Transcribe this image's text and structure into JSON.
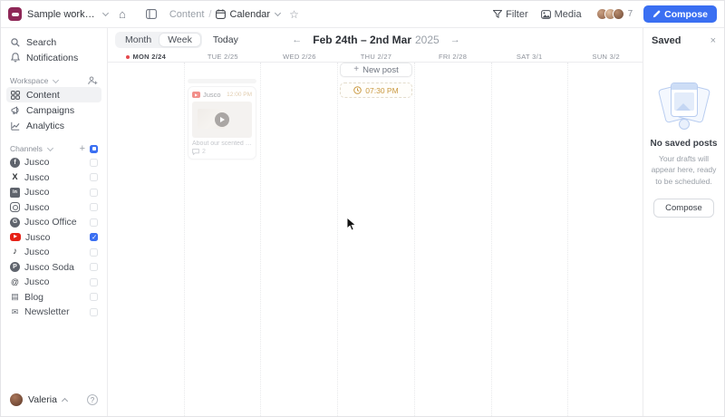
{
  "topbar": {
    "workspace_name": "Sample workspa...",
    "breadcrumb": {
      "section": "Content",
      "separator": "/",
      "page": "Calendar"
    },
    "filter_label": "Filter",
    "media_label": "Media",
    "members_count": "7",
    "compose_label": "Compose"
  },
  "sidebar": {
    "search_label": "Search",
    "notifications_label": "Notifications",
    "workspace_header": "Workspace",
    "nav": [
      {
        "label": "Content",
        "active": true
      },
      {
        "label": "Campaigns",
        "active": false
      },
      {
        "label": "Analytics",
        "active": false
      }
    ],
    "channels_header": "Channels",
    "channels": [
      {
        "label": "Jusco",
        "network": "facebook",
        "checked": false
      },
      {
        "label": "Jusco",
        "network": "x",
        "checked": false
      },
      {
        "label": "Jusco",
        "network": "linkedin",
        "checked": false
      },
      {
        "label": "Jusco",
        "network": "instagram",
        "checked": false
      },
      {
        "label": "Jusco Office",
        "network": "google-business",
        "checked": false
      },
      {
        "label": "Jusco",
        "network": "youtube",
        "checked": true
      },
      {
        "label": "Jusco",
        "network": "tiktok",
        "checked": false
      },
      {
        "label": "Jusco Soda",
        "network": "pinterest",
        "checked": false
      },
      {
        "label": "Jusco",
        "network": "threads",
        "checked": false
      },
      {
        "label": "Blog",
        "network": "blog",
        "checked": false
      },
      {
        "label": "Newsletter",
        "network": "newsletter",
        "checked": false
      }
    ],
    "user_name": "Valeria"
  },
  "calendar": {
    "toolbar": {
      "month_label": "Month",
      "week_label": "Week",
      "selected_view": "Week",
      "today_label": "Today",
      "range": "Feb 24th – 2nd Mar",
      "year": "2025"
    },
    "days": [
      {
        "label": "MON 2/24",
        "today": true
      },
      {
        "label": "TUE 2/25",
        "today": false
      },
      {
        "label": "WED 2/26",
        "today": false
      },
      {
        "label": "THU 2/27",
        "today": false
      },
      {
        "label": "FRI 2/28",
        "today": false
      },
      {
        "label": "SAT 3/1",
        "today": false
      },
      {
        "label": "SUN 3/2",
        "today": false
      }
    ],
    "ghost_post": {
      "channel": "Jusco",
      "network": "youtube",
      "time": "12:00 PM",
      "caption": "About our scented drink lab...",
      "comments_count": "2"
    },
    "new_post_label": "New post",
    "timeslot_time": "07:30 PM"
  },
  "saved_panel": {
    "title": "Saved",
    "empty_title": "No saved posts",
    "empty_subtitle": "Your drafts will appear here, ready to be scheduled.",
    "compose_label": "Compose"
  },
  "colors": {
    "accent_blue": "#3a6ff2",
    "brand_maroon": "#8e2757",
    "youtube_red": "#e62117",
    "time_orange": "#c9983f",
    "today_red": "#e5484d"
  }
}
